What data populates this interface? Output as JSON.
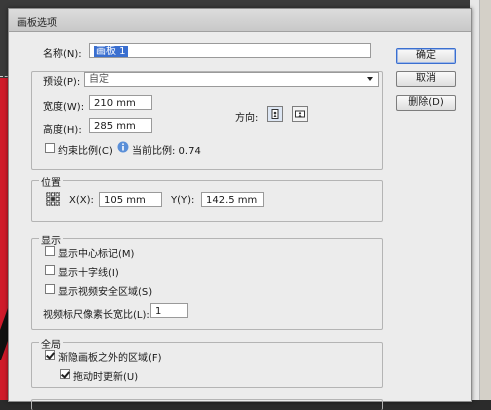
{
  "dialog": {
    "title": "画板选项"
  },
  "name": {
    "label": "名称(N):",
    "value": "画板 1"
  },
  "preset": {
    "label": "预设(P):",
    "value": "自定"
  },
  "width": {
    "label": "宽度(W):",
    "value": "210 mm"
  },
  "height": {
    "label": "高度(H):",
    "value": "285 mm"
  },
  "orientation": {
    "label": "方向:",
    "portrait_icon": "portrait-orientation-icon",
    "landscape_icon": "landscape-orientation-icon"
  },
  "constrain": {
    "label": "约束比例(C)",
    "checked": false
  },
  "ratio": {
    "label": "当前比例: 0.74",
    "icon": "info-icon"
  },
  "position": {
    "group_label": "位置",
    "x_label": "X(X):",
    "x_value": "105 mm",
    "y_label": "Y(Y):",
    "y_value": "142.5 mm",
    "reference_icon": "reference-point-icon"
  },
  "display": {
    "group_label": "显示",
    "options": [
      {
        "label": "显示中心标记(M)",
        "checked": false
      },
      {
        "label": "显示十字线(I)",
        "checked": false
      },
      {
        "label": "显示视频安全区域(S)",
        "checked": false
      }
    ],
    "pixel_ratio_label": "视频标尺像素长宽比(L):",
    "pixel_ratio_value": "1"
  },
  "global": {
    "group_label": "全局",
    "options": [
      {
        "label": "渐隐画板之外的区域(F)",
        "checked": true
      },
      {
        "label": "拖动时更新(U)",
        "checked": true
      }
    ]
  },
  "buttons": {
    "ok": "确定",
    "cancel": "取消",
    "delete": "删除(D)"
  }
}
